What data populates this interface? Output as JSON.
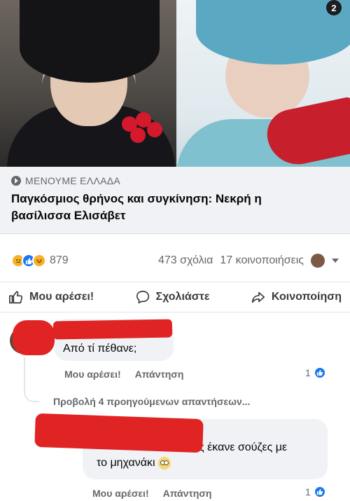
{
  "post": {
    "badge_count": "2",
    "source": "ΜΕΝΟΥΜΕ ΕΛΛΑΔΑ",
    "headline_line1": "Παγκόσμιος θρήνος και συγκίνηση: Νεκρή η",
    "headline_line2": "βασίλισσα Ελισάβετ",
    "reaction_icons": [
      "sad-icon",
      "like-icon",
      "haha-icon"
    ],
    "reaction_count": "879",
    "comments_count": "473 σχόλια",
    "shares_count": "17 κοινοποιήσεις"
  },
  "actions": {
    "like": "Μου αρέσει!",
    "comment": "Σχολιάστε",
    "share": "Κοινοποίηση"
  },
  "comments": [
    {
      "text": "Από τί πέθανε;",
      "like_label": "Μου αρέσει!",
      "reply_label": "Απάντηση",
      "likes": "1"
    },
    {
      "text_line1": "ς έκανε σούζες με",
      "text_line2": "το μηχανάκι",
      "like_label": "Μου αρέσει!",
      "reply_label": "Απάντηση",
      "likes": "1"
    }
  ],
  "view_previous": "Προβολή 4 προηγούμενων απαντήσεων...",
  "colors": {
    "accent": "#1877f2",
    "redaction": "#e02424",
    "bubble": "#f0f2f5"
  }
}
